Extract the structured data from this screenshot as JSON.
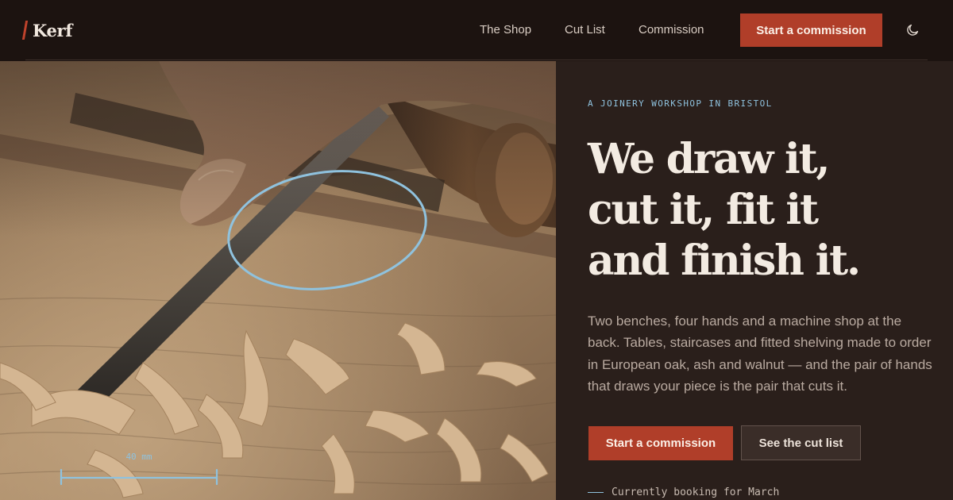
{
  "brand": {
    "name": "Kerf"
  },
  "nav": {
    "links": [
      {
        "label": "The Shop"
      },
      {
        "label": "Cut List"
      },
      {
        "label": "Commission"
      }
    ],
    "cta_label": "Start a commission",
    "theme_toggle_icon": "moon-icon"
  },
  "hero": {
    "image": {
      "subject": "chisel paring wood with shavings",
      "icons": [
        "chisel",
        "wood-shavings",
        "circle-annotation",
        "scale-bar"
      ],
      "scale_label": "40 mm"
    },
    "eyebrow": "A JOINERY WORKSHOP IN BRISTOL",
    "headline": [
      "We draw it,",
      "cut it, fit it",
      "and finish it."
    ],
    "body": "Two benches, four hands and a machine shop at the back. Tables, staircases and fitted shelving made to order in European oak, ash and walnut — and the pair of hands that draws your piece is the pair that cuts it.",
    "primary_cta": "Start a commission",
    "secondary_cta": "See the cut list",
    "status": "Currently booking for March"
  },
  "colors": {
    "background": "#1c1310",
    "panel": "#2a1f1b",
    "accent": "#b03e29",
    "annotation": "#8fc2de",
    "text": "#f3ebe2",
    "muted": "#b9aaa0"
  }
}
